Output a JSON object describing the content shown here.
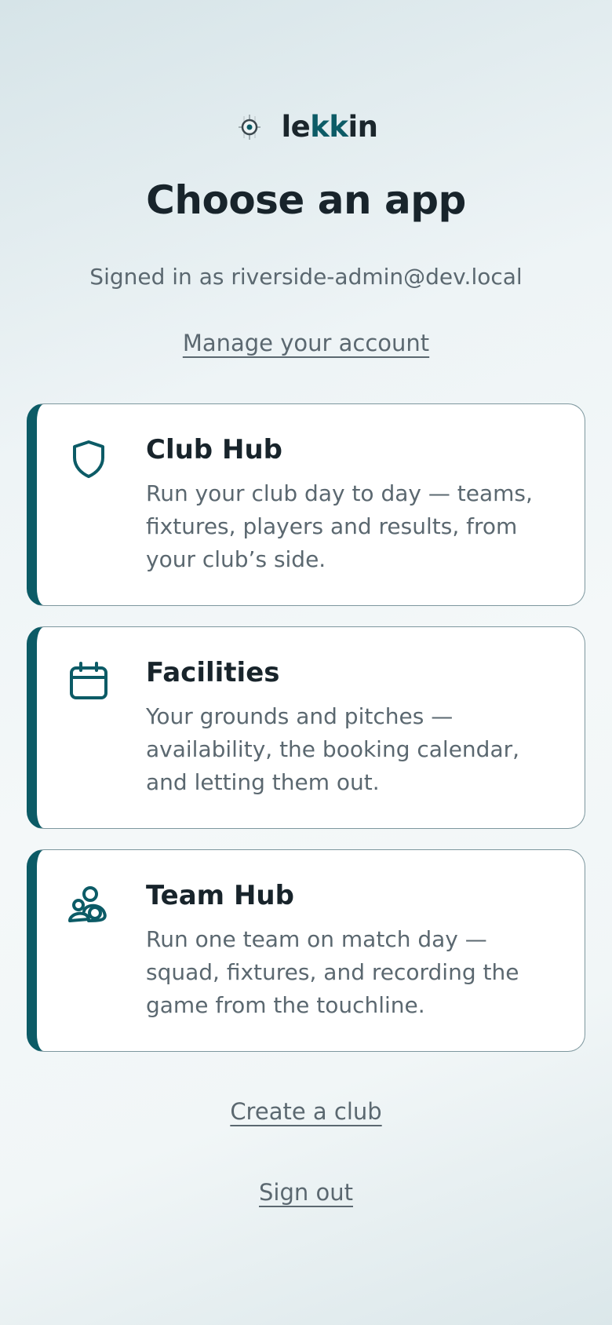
{
  "brand": {
    "name_prefix": "le",
    "name_accent": "kk",
    "name_suffix": "in",
    "logo_icon": "crosshair-target-icon",
    "accent_color": "#0c5b66"
  },
  "page": {
    "title": "Choose an app",
    "signed_in_text": "Signed in as riverside-admin@dev.local",
    "manage_account_label": "Manage your account"
  },
  "apps": [
    {
      "icon": "shield-icon",
      "title": "Club Hub",
      "description": "Run your club day to day — teams, fixtures, players and results, from your club’s side."
    },
    {
      "icon": "calendar-icon",
      "title": "Facilities",
      "description": "Your grounds and pitches — availability, the booking calendar, and letting them out."
    },
    {
      "icon": "people-group-icon",
      "title": "Team Hub",
      "description": "Run one team on match day — squad, fixtures, and recording the game from the touchline."
    }
  ],
  "footer": {
    "create_club_label": "Create a club",
    "sign_out_label": "Sign out"
  }
}
